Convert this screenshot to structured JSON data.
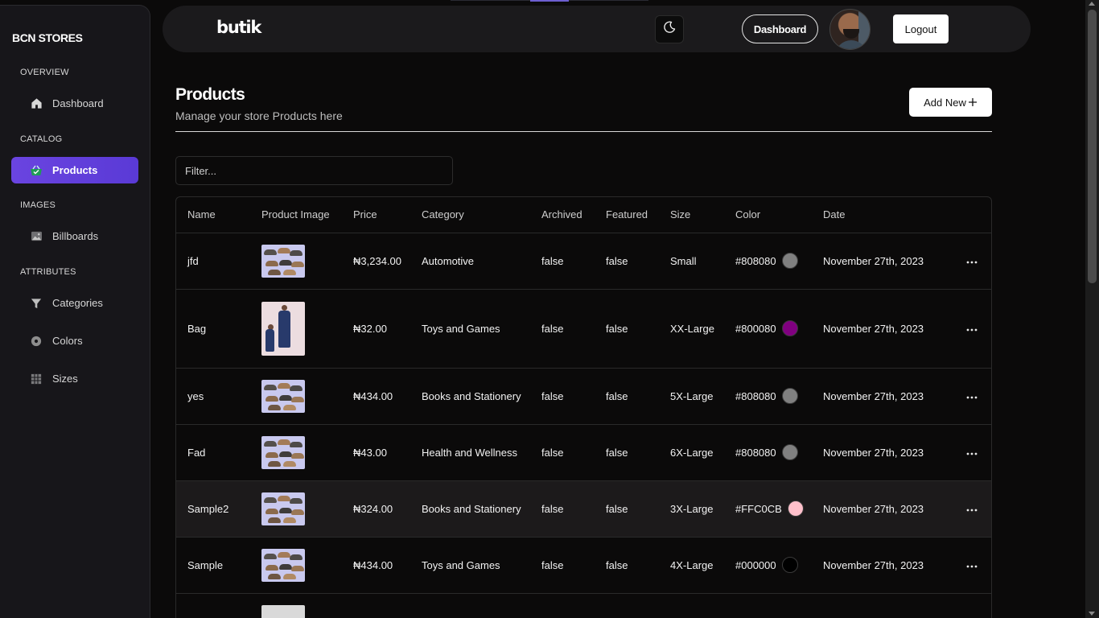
{
  "sidebar": {
    "brand": "BCN STORES",
    "sections": [
      {
        "label": "OVERVIEW",
        "items": [
          {
            "label": "Dashboard",
            "icon": "home-icon"
          }
        ]
      },
      {
        "label": "CATALOG",
        "items": [
          {
            "label": "Products",
            "icon": "basket-icon",
            "active": true
          }
        ]
      },
      {
        "label": "IMAGES",
        "items": [
          {
            "label": "Billboards",
            "icon": "image-icon"
          }
        ]
      },
      {
        "label": "ATTRIBUTES",
        "items": [
          {
            "label": "Categories",
            "icon": "filter-icon"
          },
          {
            "label": "Colors",
            "icon": "palette-icon"
          },
          {
            "label": "Sizes",
            "icon": "grid-icon"
          }
        ]
      }
    ]
  },
  "topbar": {
    "logo": "butik",
    "theme_icon": "moon-icon",
    "dashboard_label": "Dashboard",
    "logout_label": "Logout"
  },
  "header": {
    "title": "Products",
    "subtitle": "Manage your store Products here",
    "add_new_label": "Add New"
  },
  "filter": {
    "placeholder": "Filter..."
  },
  "table": {
    "columns": [
      "Name",
      "Product Image",
      "Price",
      "Category",
      "Archived",
      "Featured",
      "Size",
      "Color",
      "Date"
    ],
    "rows": [
      {
        "name": "jfd",
        "price": "₦3,234.00",
        "category": "Automotive",
        "archived": "false",
        "featured": "false",
        "size": "Small",
        "color": "#808080",
        "date": "November 27th, 2023",
        "image": "shoes"
      },
      {
        "name": "Bag",
        "price": "₦32.00",
        "category": "Toys and Games",
        "archived": "false",
        "featured": "false",
        "size": "XX-Large",
        "color": "#800080",
        "date": "November 27th, 2023",
        "image": "dress"
      },
      {
        "name": "yes",
        "price": "₦434.00",
        "category": "Books and Stationery",
        "archived": "false",
        "featured": "false",
        "size": "5X-Large",
        "color": "#808080",
        "date": "November 27th, 2023",
        "image": "shoes"
      },
      {
        "name": "Fad",
        "price": "₦43.00",
        "category": "Health and Wellness",
        "archived": "false",
        "featured": "false",
        "size": "6X-Large",
        "color": "#808080",
        "date": "November 27th, 2023",
        "image": "shoes"
      },
      {
        "name": "Sample2",
        "price": "₦324.00",
        "category": "Books and Stationery",
        "archived": "false",
        "featured": "false",
        "size": "3X-Large",
        "color": "#FFC0CB",
        "date": "November 27th, 2023",
        "image": "shoes",
        "highlighted": true
      },
      {
        "name": "Sample",
        "price": "₦434.00",
        "category": "Toys and Games",
        "archived": "false",
        "featured": "false",
        "size": "4X-Large",
        "color": "#000000",
        "date": "November 27th, 2023",
        "image": "shoes"
      }
    ]
  },
  "colors": {
    "accent": "#6a44e0",
    "background": "#0b0a0a",
    "sidebar": "#17161a"
  }
}
